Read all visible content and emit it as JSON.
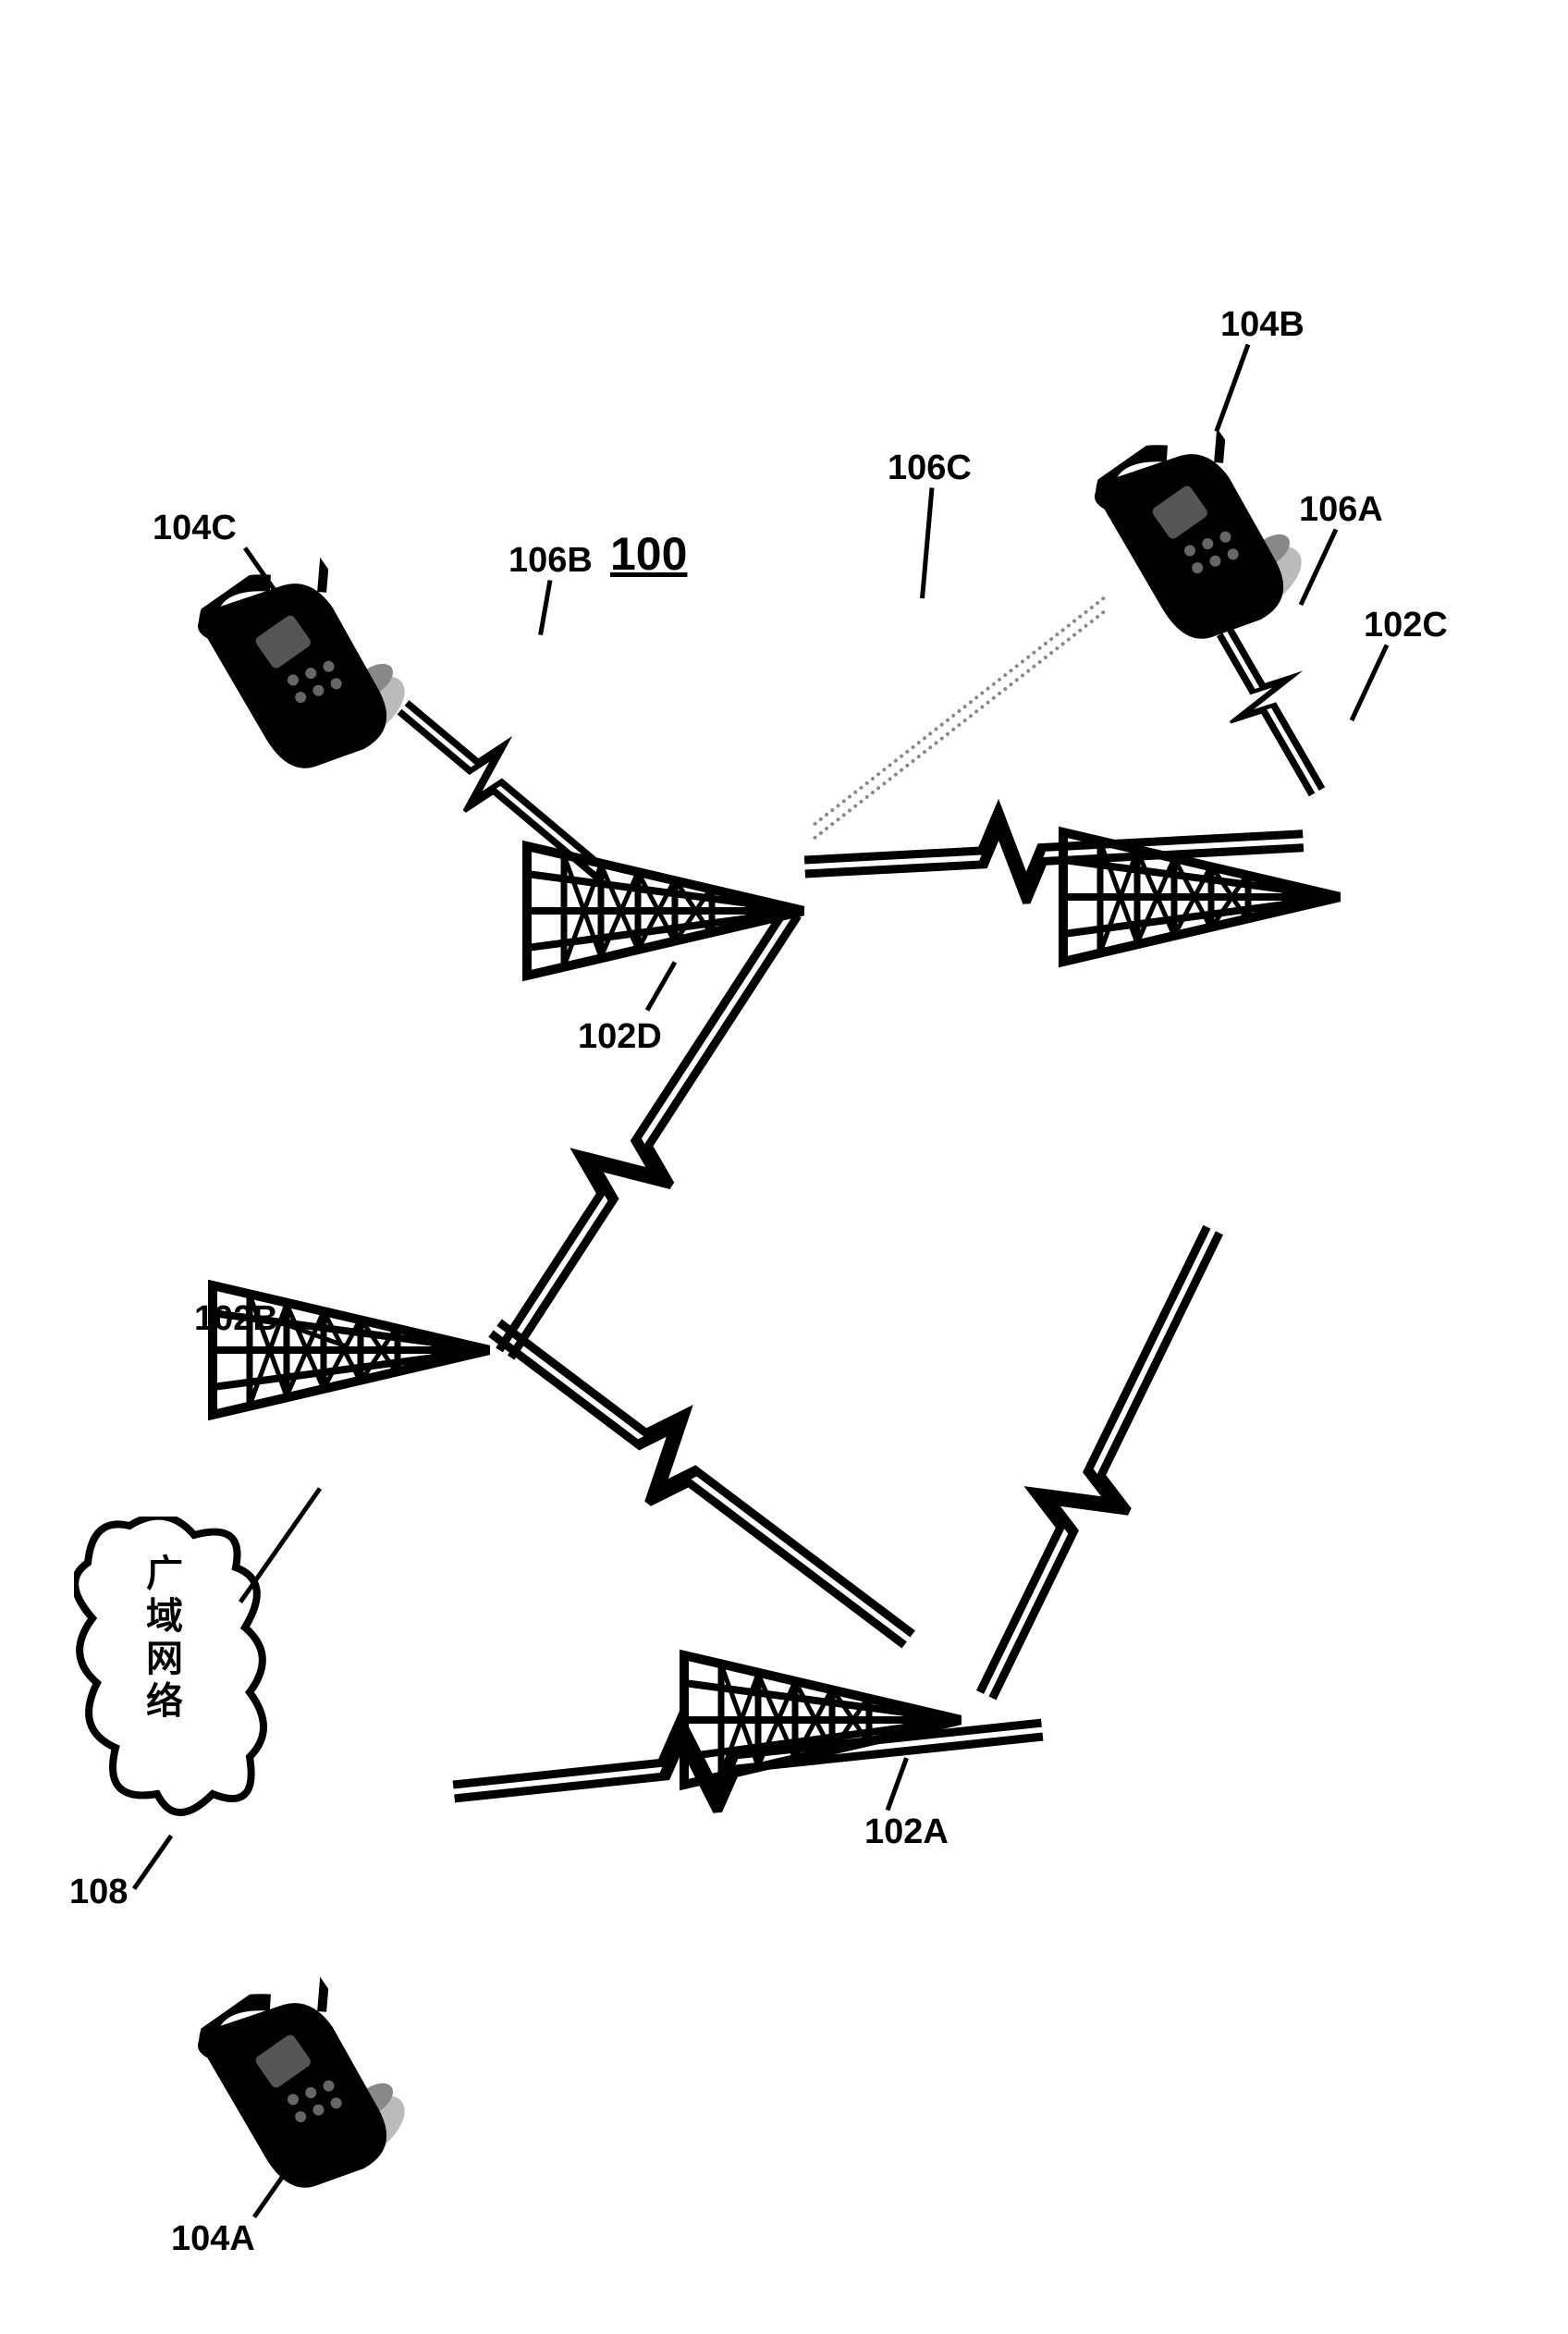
{
  "figure": "100",
  "labels": {
    "l104C": "104C",
    "l106B": "106B",
    "l106C": "106C",
    "l104B": "104B",
    "l106A": "106A",
    "l102D": "102D",
    "l102B": "102B",
    "l108": "108",
    "l102A": "102A",
    "l102C": "102C",
    "l104A": "104A"
  },
  "cloud_text": "广域网络",
  "nodes": {
    "towers": [
      "102A",
      "102B",
      "102C",
      "102D"
    ],
    "phones": [
      "104A",
      "104B",
      "104C"
    ],
    "links": [
      "106A",
      "106B",
      "106C"
    ],
    "network": "108"
  }
}
